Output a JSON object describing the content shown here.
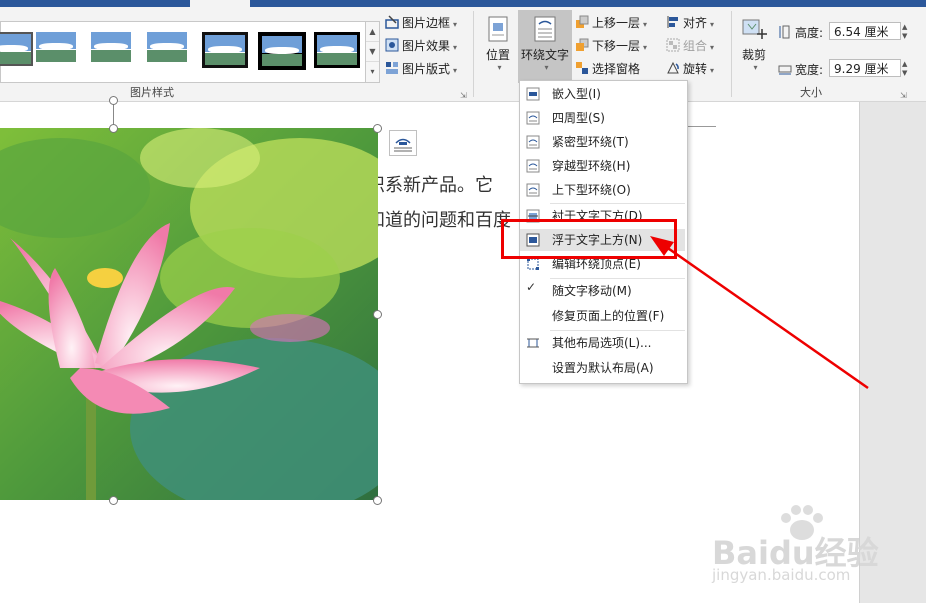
{
  "ribbon": {
    "picture_styles_label": "图片样式",
    "size_label": "大小",
    "picture_border": "图片边框",
    "picture_effects": "图片效果",
    "picture_layout": "图片版式",
    "position": "位置",
    "wrap_text": "环绕文字",
    "bring_forward": "上移一层",
    "send_backward": "下移一层",
    "selection_pane": "选择窗格",
    "align": "对齐",
    "group": "组合",
    "rotate": "旋转",
    "crop": "裁剪",
    "height_label": "高度:",
    "height_value": "6.54 厘米",
    "width_label": "宽度:",
    "width_value": "9.29 厘米"
  },
  "document": {
    "line1": "织系新产品。它",
    "line2": "知道的问题和百度"
  },
  "wrap_menu": {
    "items": [
      {
        "label": "嵌入型(I)",
        "icon": "inline-wrap-icon"
      },
      {
        "label": "四周型(S)",
        "icon": "square-wrap-icon"
      },
      {
        "label": "紧密型环绕(T)",
        "icon": "tight-wrap-icon"
      },
      {
        "label": "穿越型环绕(H)",
        "icon": "through-wrap-icon"
      },
      {
        "label": "上下型环绕(O)",
        "icon": "top-bottom-wrap-icon"
      },
      {
        "label": "衬于文字下方(D)",
        "icon": "behind-text-icon"
      },
      {
        "label": "浮于文字上方(N)",
        "icon": "in-front-text-icon"
      },
      {
        "label": "编辑环绕顶点(E)",
        "icon": "edit-wrap-points-icon"
      },
      {
        "label": "随文字移动(M)",
        "icon": "check-icon"
      },
      {
        "label": "修复页面上的位置(F)",
        "icon": ""
      },
      {
        "label": "其他布局选项(L)...",
        "icon": "layout-options-icon"
      },
      {
        "label": "设置为默认布局(A)",
        "icon": ""
      }
    ]
  },
  "watermark": {
    "brand": "Baidu经验",
    "url": "jingyan.baidu.com"
  },
  "colors": {
    "ribbon_blue": "#2b579a",
    "highlight_red": "#e00000"
  }
}
